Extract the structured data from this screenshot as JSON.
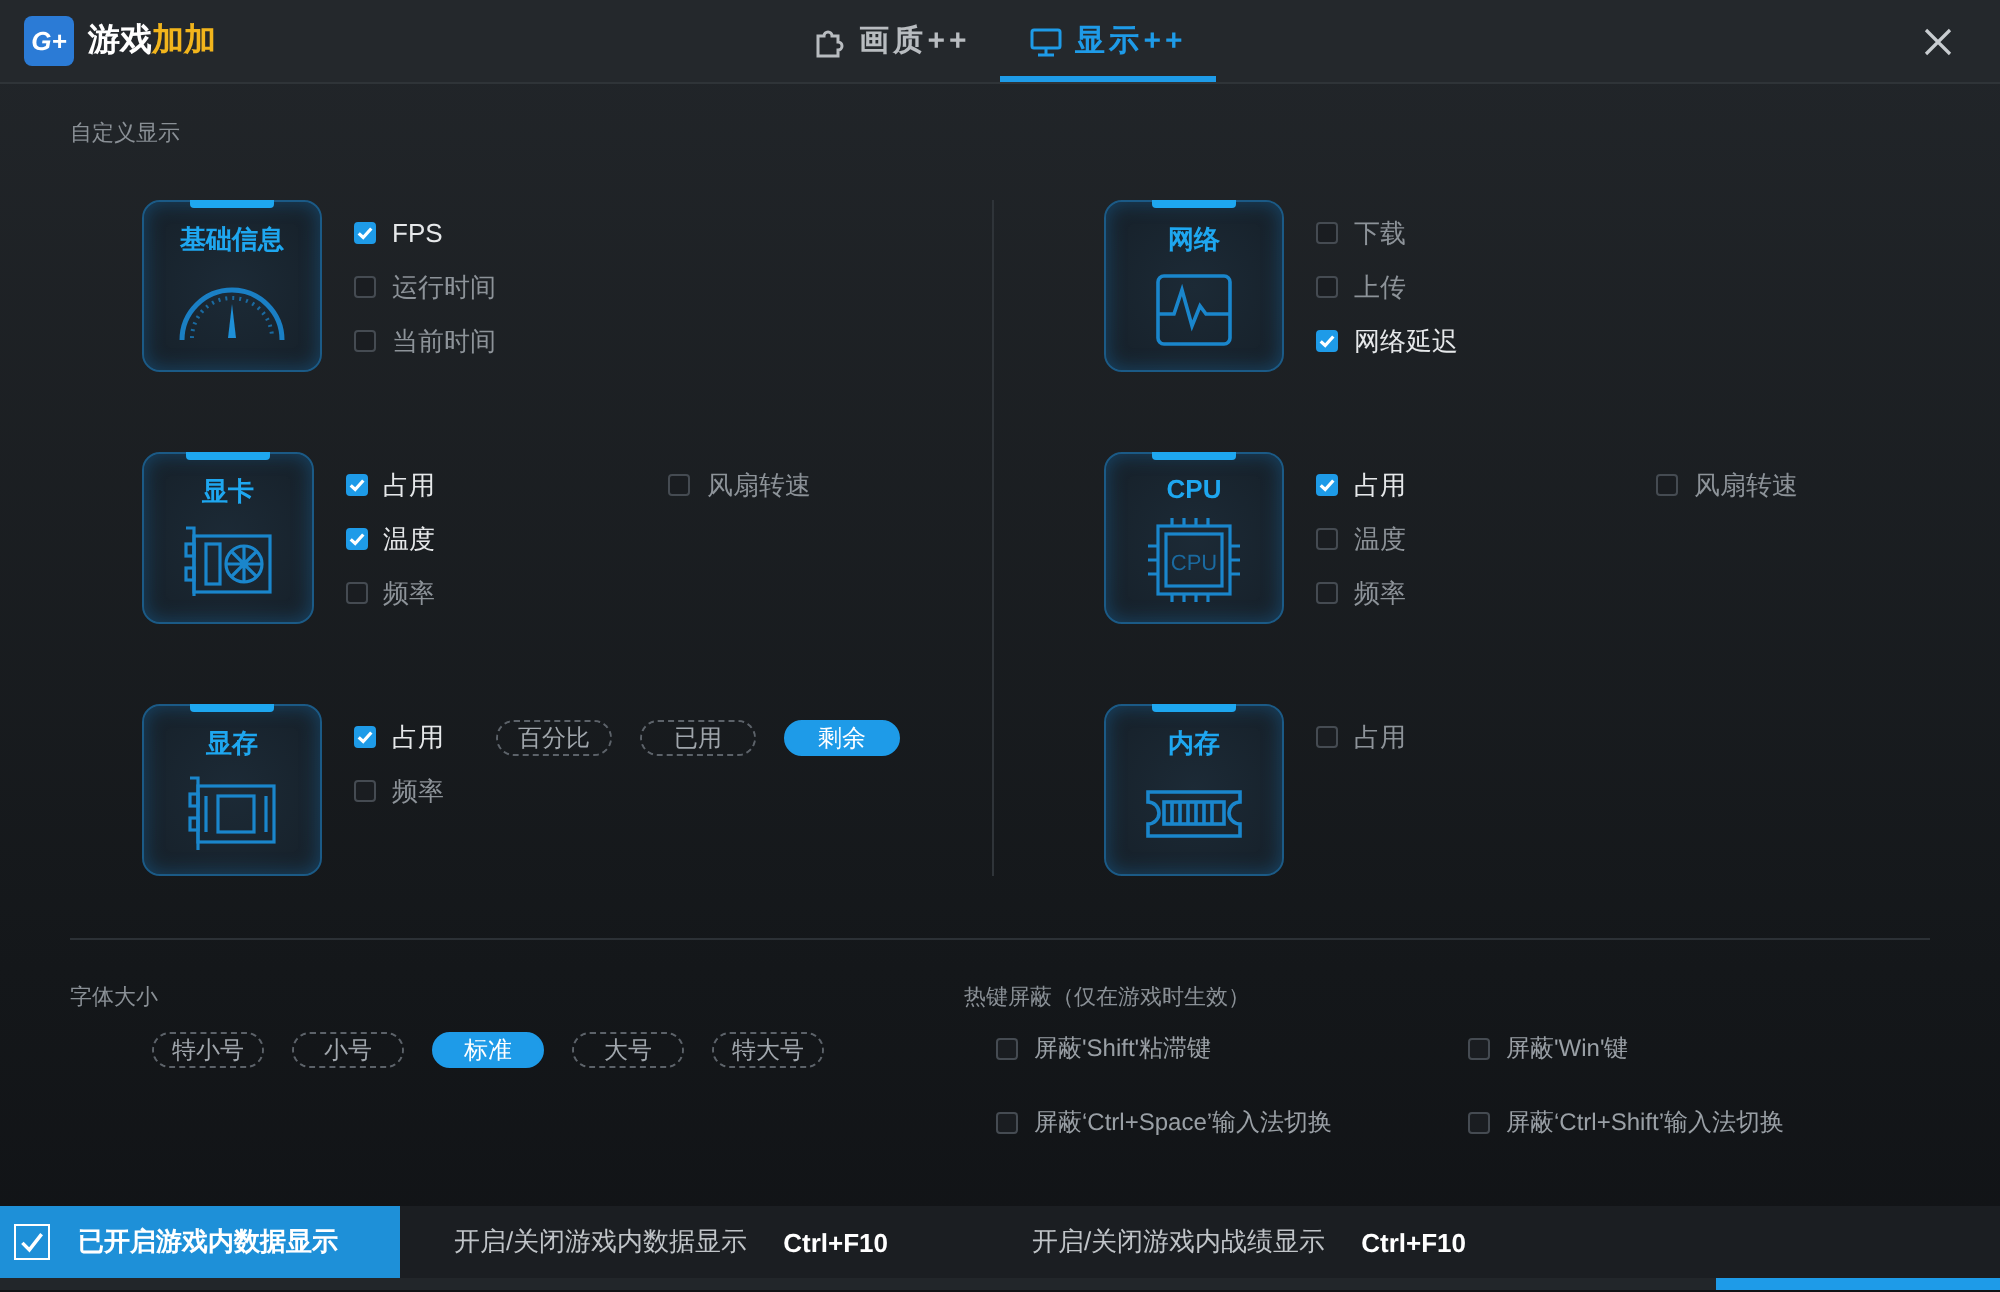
{
  "app": {
    "logo_text": "G+",
    "name": "游戏",
    "name_accent": "加加"
  },
  "tabs": [
    {
      "label": "画质++",
      "selected": false,
      "kind": "puzzle"
    },
    {
      "label": "显示++",
      "selected": true,
      "kind": "monitor"
    }
  ],
  "section_title": "自定义显示",
  "columns": [
    [
      {
        "title": "基础信息",
        "kind": "gauge",
        "options": [
          {
            "label": "FPS",
            "checked": true
          },
          {
            "label": "运行时间",
            "checked": false
          },
          {
            "label": "当前时间",
            "checked": false
          }
        ]
      },
      {
        "title": "显卡",
        "kind": "gpu",
        "options": [
          {
            "label": "占用",
            "checked": true
          },
          {
            "label": "温度",
            "checked": true
          },
          {
            "label": "频率",
            "checked": false
          }
        ],
        "extra_options": [
          {
            "label": "风扇转速",
            "checked": false
          }
        ]
      },
      {
        "title": "显存",
        "kind": "vram",
        "options": [
          {
            "label": "占用",
            "checked": true
          },
          {
            "label": "频率",
            "checked": false
          }
        ],
        "chips": [
          {
            "label": "百分比",
            "selected": false
          },
          {
            "label": "已用",
            "selected": false
          },
          {
            "label": "剩余",
            "selected": true
          }
        ]
      }
    ],
    [
      {
        "title": "网络",
        "kind": "network",
        "options": [
          {
            "label": "下载",
            "checked": false
          },
          {
            "label": "上传",
            "checked": false
          },
          {
            "label": "网络延迟",
            "checked": true
          }
        ]
      },
      {
        "title": "CPU",
        "kind": "cpu",
        "icon_text": "CPU",
        "options": [
          {
            "label": "占用",
            "checked": true
          },
          {
            "label": "温度",
            "checked": false
          },
          {
            "label": "频率",
            "checked": false
          }
        ],
        "extra_options": [
          {
            "label": "风扇转速",
            "checked": false
          }
        ]
      },
      {
        "title": "内存",
        "kind": "ram",
        "options": [
          {
            "label": "占用",
            "checked": false
          }
        ]
      }
    ]
  ],
  "font_size": {
    "title": "字体大小",
    "options": [
      {
        "label": "特小号",
        "selected": false
      },
      {
        "label": "小号",
        "selected": false
      },
      {
        "label": "标准",
        "selected": true
      },
      {
        "label": "大号",
        "selected": false
      },
      {
        "label": "特大号",
        "selected": false
      }
    ]
  },
  "hotkeys": {
    "title": "热键屏蔽（仅在游戏时生效）",
    "items": [
      {
        "label": "屏蔽'Shift'粘滞键",
        "checked": false
      },
      {
        "label": "屏蔽'Win'键",
        "checked": false
      },
      {
        "label": "屏蔽‘Ctrl+Space’输入法切换",
        "checked": false
      },
      {
        "label": "屏蔽‘Ctrl+Shift’输入法切换",
        "checked": false
      }
    ]
  },
  "footer": {
    "toggle": {
      "label": "已开启游戏内数据显示",
      "checked": true
    },
    "shortcuts": [
      {
        "label": "开启/关闭游戏内数据显示",
        "keys": "Ctrl+F10"
      },
      {
        "label": "开启/关闭游戏内战绩显示",
        "keys": "Ctrl+F10"
      }
    ]
  }
}
